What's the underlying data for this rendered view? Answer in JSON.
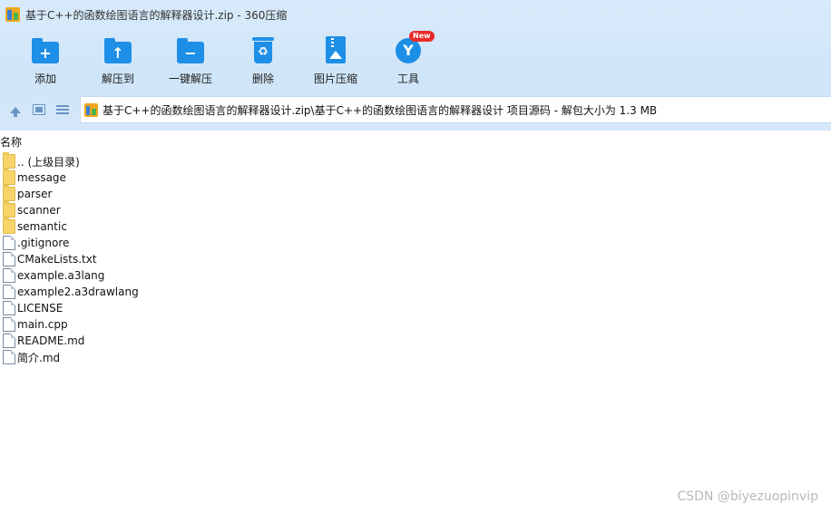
{
  "window": {
    "title": "基于C++的函数绘图语言的解释器设计.zip - 360压缩"
  },
  "toolbar": {
    "items": [
      {
        "label": "添加",
        "icon": "add-folder-icon"
      },
      {
        "label": "解压到",
        "icon": "extract-to-icon"
      },
      {
        "label": "一键解压",
        "icon": "one-click-extract-icon"
      },
      {
        "label": "删除",
        "icon": "recycle-bin-icon"
      },
      {
        "label": "图片压缩",
        "icon": "image-compress-icon"
      },
      {
        "label": "工具",
        "icon": "tools-icon",
        "badge": "New"
      }
    ]
  },
  "address": {
    "path": "基于C++的函数绘图语言的解释器设计.zip\\基于C++的函数绘图语言的解释器设计 项目源码 - 解包大小为 1.3 MB"
  },
  "list": {
    "column_name": "名称",
    "items": [
      {
        "name": ".. (上级目录)",
        "type": "folder"
      },
      {
        "name": "message",
        "type": "folder"
      },
      {
        "name": "parser",
        "type": "folder"
      },
      {
        "name": "scanner",
        "type": "folder"
      },
      {
        "name": "semantic",
        "type": "folder"
      },
      {
        "name": ".gitignore",
        "type": "file"
      },
      {
        "name": "CMakeLists.txt",
        "type": "file"
      },
      {
        "name": "example.a3lang",
        "type": "file"
      },
      {
        "name": "example2.a3drawlang",
        "type": "file"
      },
      {
        "name": "LICENSE",
        "type": "file"
      },
      {
        "name": "main.cpp",
        "type": "file"
      },
      {
        "name": "README.md",
        "type": "file"
      },
      {
        "name": "简介.md",
        "type": "file"
      }
    ]
  },
  "watermark": "CSDN @biyezuopinvip",
  "colors": {
    "accent": "#1e8fe6",
    "toolbar_bg": "#d5e8f9",
    "badge": "#ea2a2a"
  }
}
